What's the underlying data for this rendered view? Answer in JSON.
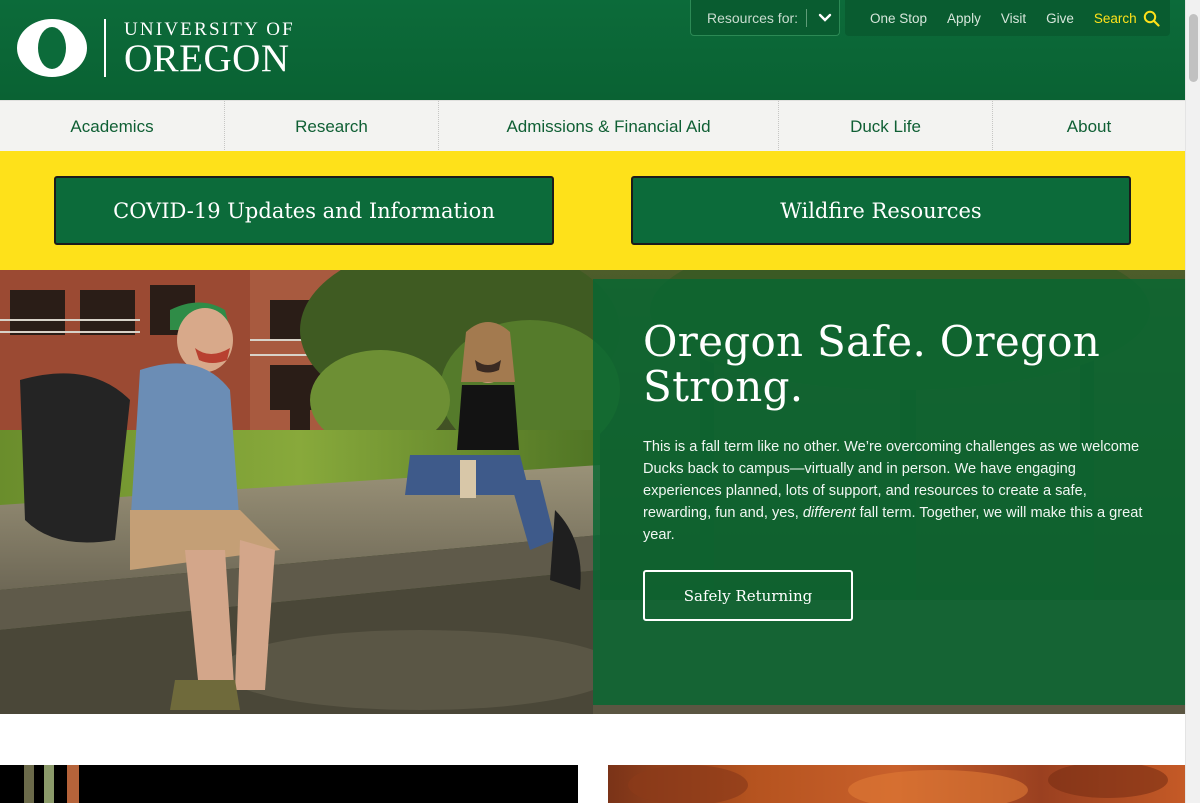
{
  "colors": {
    "brand_green": "#0c6b3a",
    "brand_yellow": "#fee11a",
    "nav_background": "#f3f3f1"
  },
  "header": {
    "logo_line1": "UNIVERSITY OF",
    "logo_line2": "OREGON",
    "resources_label": "Resources for:",
    "utility_links": [
      "One Stop",
      "Apply",
      "Visit",
      "Give"
    ],
    "search_label": "Search",
    "icons": {
      "resources": "chevron-down-icon",
      "search": "search-icon"
    }
  },
  "nav": {
    "items": [
      "Academics",
      "Research",
      "Admissions & Financial Aid",
      "Duck Life",
      "About"
    ]
  },
  "banner": {
    "covid_label": "COVID-19 Updates and Information",
    "wildfire_label": "Wildfire Resources"
  },
  "hero": {
    "title": "Oregon Safe. Oregon Strong.",
    "body_before": "This is a fall term like no other. We’re overcoming challenges as we welcome Ducks back to campus—virtually and in person. We have engaging experiences planned, lots of support, and resources to create a safe, rewarding, fun and, yes, ",
    "body_emphasis": "different",
    "body_after": " fall term. Together, we will make this a great year.",
    "button_label": "Safely Returning"
  }
}
